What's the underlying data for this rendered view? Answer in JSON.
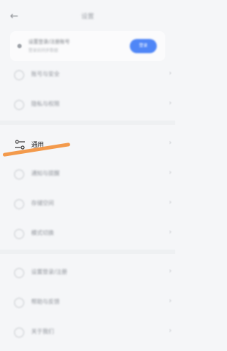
{
  "header": {
    "back_icon": "arrow-left-icon",
    "title": "设置"
  },
  "login_card": {
    "title": "设置登录/注册账号",
    "subtitle": "登录后同步数据",
    "button_label": "登录",
    "accent": "#4f86f7"
  },
  "rows": [
    {
      "label": "账号与安全",
      "icon": "user-icon"
    },
    {
      "label": "隐私与权限",
      "icon": "search-icon"
    },
    {
      "label": "通用",
      "icon": "sliders-icon"
    },
    {
      "label": "通知与提醒",
      "icon": "bell-icon"
    },
    {
      "label": "存储空间",
      "icon": "storage-icon"
    },
    {
      "label": "模式切换",
      "icon": "mode-icon"
    },
    {
      "label": "设置登录/注册",
      "icon": "account-icon"
    },
    {
      "label": "帮助与反馈",
      "icon": "help-icon"
    },
    {
      "label": "关于我们",
      "icon": "info-icon"
    }
  ],
  "highlight_color": "#f39a4c"
}
